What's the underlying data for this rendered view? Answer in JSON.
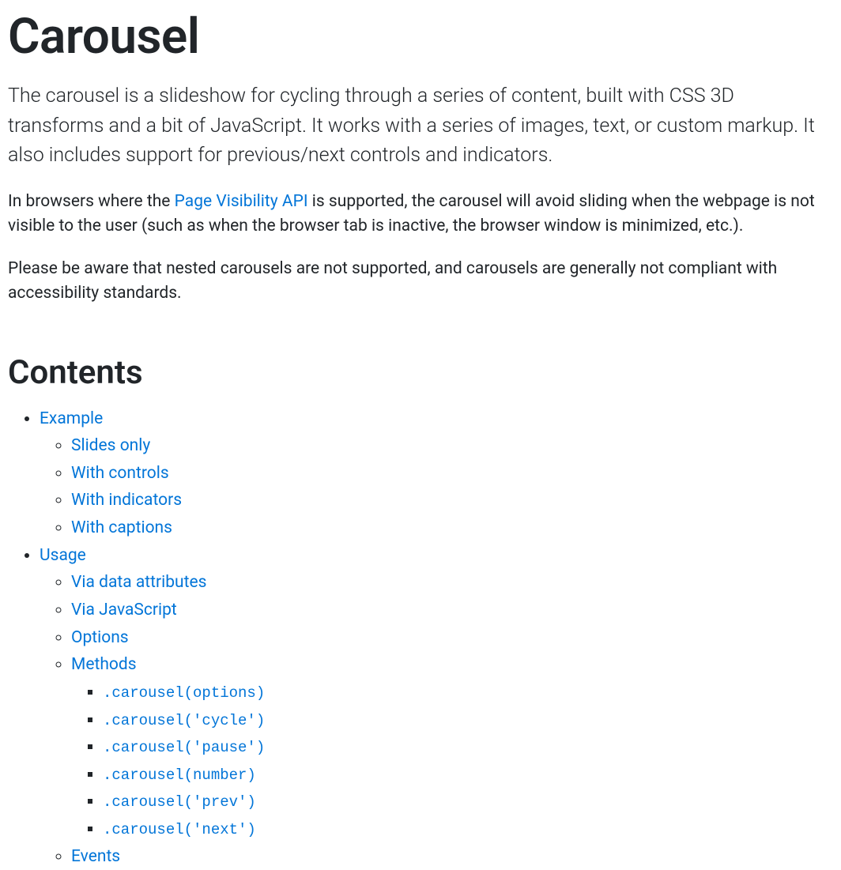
{
  "title": "Carousel",
  "lead": "The carousel is a slideshow for cycling through a series of content, built with CSS 3D transforms and a bit of JavaScript. It works with a series of images, text, or custom markup. It also includes support for previous/next controls and indicators.",
  "para1_before": "In browsers where the ",
  "para1_link": "Page Visibility API",
  "para1_after": " is supported, the carousel will avoid sliding when the webpage is not visible to the user (such as when the browser tab is inactive, the browser window is minimized, etc.).",
  "para2": "Please be aware that nested carousels are not supported, and carousels are generally not compliant with accessibility standards.",
  "contents_heading": "Contents",
  "toc": {
    "example": {
      "label": "Example",
      "children": [
        "Slides only",
        "With controls",
        "With indicators",
        "With captions"
      ]
    },
    "usage": {
      "label": "Usage",
      "children": {
        "via_data": "Via data attributes",
        "via_js": "Via JavaScript",
        "options": "Options",
        "methods": {
          "label": "Methods",
          "children": [
            ".carousel(options)",
            ".carousel('cycle')",
            ".carousel('pause')",
            ".carousel(number)",
            ".carousel('prev')",
            ".carousel('next')"
          ]
        },
        "events": "Events"
      }
    }
  }
}
